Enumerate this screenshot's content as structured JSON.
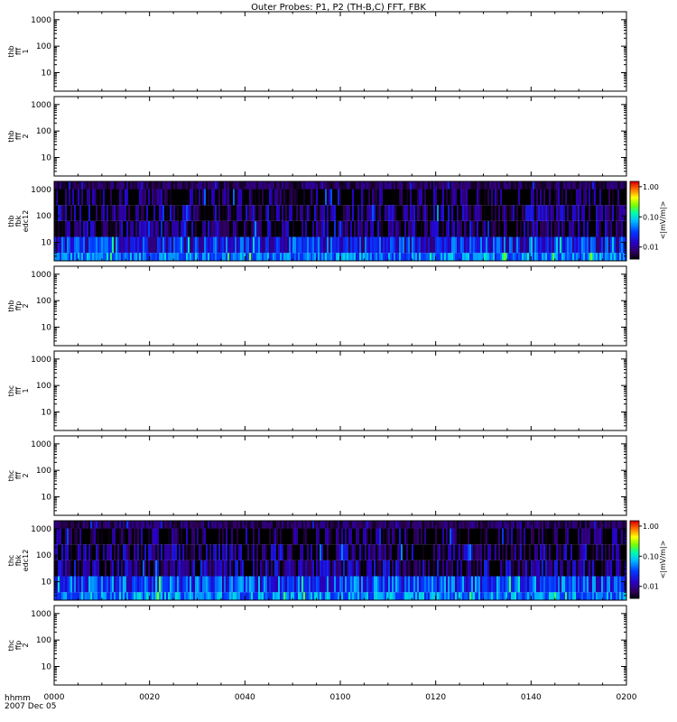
{
  "figure": {
    "title": "Outer Probes: P1, P2 (TH-B,C) FFT, FBK",
    "time_axis": {
      "ticks": [
        "0000",
        "0020",
        "0040",
        "0100",
        "0120",
        "0140",
        "0200"
      ],
      "label_line1": "hhmm",
      "label_line2": "2007 Dec 05"
    }
  },
  "chart_data": [
    {
      "type": "heatmap",
      "panel": "thb-fff-p1",
      "ylabel_lines": [
        "thb",
        "fff",
        "1"
      ],
      "yscale": "log",
      "ylim": [
        1,
        1000
      ],
      "yticks": [
        "1",
        "10",
        "100",
        "1000"
      ],
      "x": [
        "0000",
        "0200"
      ],
      "values": []
    },
    {
      "type": "heatmap",
      "panel": "thb-fff-p2",
      "ylabel_lines": [
        "thb",
        "fff",
        "2"
      ],
      "yscale": "log",
      "ylim": [
        1,
        1000
      ],
      "yticks": [
        "1",
        "10",
        "100",
        "1000"
      ],
      "x": [
        "0000",
        "0200"
      ],
      "values": []
    },
    {
      "type": "heatmap",
      "panel": "thb-fbk-edc12",
      "ylabel_lines": [
        "thb",
        "fbk",
        "edc12"
      ],
      "yscale": "log",
      "ylim": [
        1,
        1000
      ],
      "yticks": [
        "1",
        "10",
        "100",
        "1000"
      ],
      "x": [
        "0000",
        "0200"
      ],
      "colorbar": {
        "label": "<|mV/m|>",
        "scale": "log",
        "range": [
          0.004,
          1.5
        ],
        "ticks": [
          "1.00",
          "0.10",
          "0.01"
        ]
      },
      "bins": [
        {
          "f_low": 2,
          "f_high": 4,
          "base": 0.045,
          "vary": 0.35
        },
        {
          "f_low": 4,
          "f_high": 16,
          "base": 0.022,
          "vary": 0.45
        },
        {
          "f_low": 16,
          "f_high": 64,
          "base": 0.006,
          "vary": 0.5
        },
        {
          "f_low": 64,
          "f_high": 256,
          "base": 0.006,
          "vary": 0.55
        },
        {
          "f_low": 256,
          "f_high": 1024,
          "base": 0.004,
          "vary": 0.6
        },
        {
          "f_low": 1024,
          "f_high": 2048,
          "base": 0.007,
          "vary": 0.2
        }
      ]
    },
    {
      "type": "heatmap",
      "panel": "thb-ffp-p2",
      "ylabel_lines": [
        "thb",
        "ffp",
        "2"
      ],
      "yscale": "log",
      "ylim": [
        1,
        1000
      ],
      "yticks": [
        "1",
        "10",
        "100",
        "1000"
      ],
      "x": [
        "0000",
        "0200"
      ],
      "values": []
    },
    {
      "type": "heatmap",
      "panel": "thc-fff-p1",
      "ylabel_lines": [
        "thc",
        "fff",
        "1"
      ],
      "yscale": "log",
      "ylim": [
        1,
        1000
      ],
      "yticks": [
        "1",
        "10",
        "100",
        "1000"
      ],
      "x": [
        "0000",
        "0200"
      ],
      "values": []
    },
    {
      "type": "heatmap",
      "panel": "thc-fff-p2",
      "ylabel_lines": [
        "thc",
        "fff",
        "2"
      ],
      "yscale": "log",
      "ylim": [
        1,
        1000
      ],
      "yticks": [
        "1",
        "10",
        "100",
        "1000"
      ],
      "x": [
        "0000",
        "0200"
      ],
      "values": []
    },
    {
      "type": "heatmap",
      "panel": "thc-fbk-edc12",
      "ylabel_lines": [
        "thc",
        "fbk",
        "edc12"
      ],
      "yscale": "log",
      "ylim": [
        1,
        1000
      ],
      "yticks": [
        "1",
        "10",
        "100",
        "1000"
      ],
      "x": [
        "0000",
        "0200"
      ],
      "colorbar": {
        "label": "<|mV/m|>",
        "scale": "log",
        "range": [
          0.004,
          1.5
        ],
        "ticks": [
          "1.00",
          "0.10",
          "0.01"
        ]
      },
      "bins": [
        {
          "f_low": 2,
          "f_high": 4,
          "base": 0.05,
          "vary": 0.35
        },
        {
          "f_low": 4,
          "f_high": 16,
          "base": 0.03,
          "vary": 0.45
        },
        {
          "f_low": 16,
          "f_high": 64,
          "base": 0.008,
          "vary": 0.5
        },
        {
          "f_low": 64,
          "f_high": 256,
          "base": 0.006,
          "vary": 0.55
        },
        {
          "f_low": 256,
          "f_high": 1024,
          "base": 0.004,
          "vary": 0.6
        },
        {
          "f_low": 1024,
          "f_high": 2048,
          "base": 0.007,
          "vary": 0.2
        }
      ]
    },
    {
      "type": "heatmap",
      "panel": "thc-ffp-p2",
      "ylabel_lines": [
        "thc",
        "ffp",
        "2"
      ],
      "yscale": "log",
      "ylim": [
        1,
        1000
      ],
      "yticks": [
        "1",
        "10",
        "100",
        "1000"
      ],
      "x": [
        "0000",
        "0200"
      ],
      "values": []
    }
  ]
}
